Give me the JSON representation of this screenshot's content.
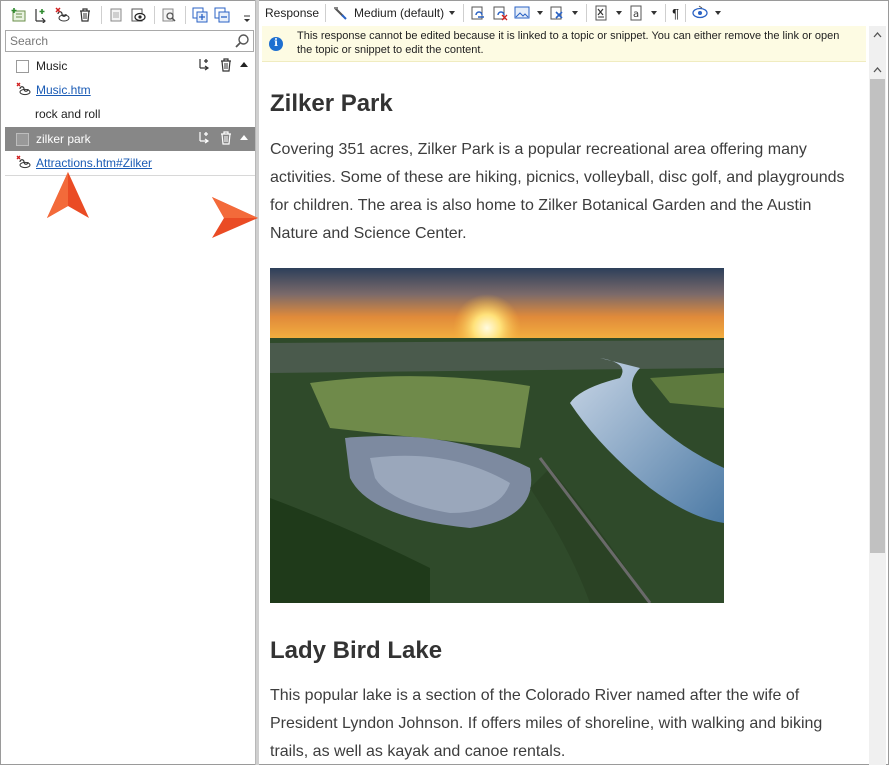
{
  "left_toolbar": {
    "icons": [
      "add-topic-icon",
      "add-link-icon",
      "remove-link-icon",
      "delete-icon",
      "copy-icon",
      "preview-icon",
      "find-icon",
      "expand-all-icon",
      "collapse-all-icon",
      "more-dropdown-icon"
    ]
  },
  "search": {
    "placeholder": "Search"
  },
  "tree": [
    {
      "label": "Music",
      "type": "phrase",
      "selected": false
    },
    {
      "label": "Music.htm",
      "type": "link"
    },
    {
      "label": "rock and roll",
      "type": "text"
    },
    {
      "label": "zilker park",
      "type": "phrase",
      "selected": true
    },
    {
      "label": "Attractions.htm#Zilker",
      "type": "link"
    }
  ],
  "right_toolbar": {
    "response_label": "Response",
    "style_value": "Medium (default)",
    "paragraph_symbol": "¶"
  },
  "notice": {
    "text": "This response cannot be edited because it is linked to a topic or snippet. You can either remove the link or open the topic or snippet to edit the content."
  },
  "content": {
    "heading1": "Zilker Park",
    "para1": "Covering 351 acres, Zilker Park is a popular recreational area offering many activities. Some of these are hiking, picnics, volleyball, disc golf, and playgrounds for children. The area is also home to Zilker Botanical Garden and the Austin Nature and Science Center.",
    "heading2": "Lady Bird Lake",
    "para2": "This popular lake is a section of the Colorado River named after the wife of President Lyndon Johnson. If offers miles of shoreline, with walking and biking trails, as well as kayak and canoe rentals."
  },
  "colors": {
    "selected_row": "#878787",
    "link": "#1a5bb5",
    "notice_bg": "#fdfbe3",
    "callout_arrow": "#ea4b24"
  }
}
